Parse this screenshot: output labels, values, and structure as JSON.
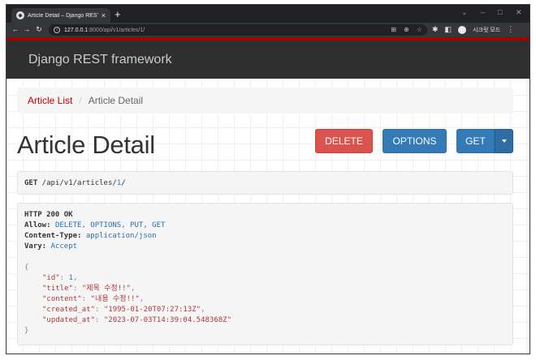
{
  "browser": {
    "tab_title": "Article Detail – Django REST fra...",
    "url_host": "127.0.0.1",
    "url_path": ":8000/api/v1/articles/1/",
    "profile_label": "시크릿 모드"
  },
  "navbar": {
    "brand": "Django REST framework"
  },
  "breadcrumb": {
    "link": "Article List",
    "separator": "/",
    "active": "Article Detail"
  },
  "page": {
    "title": "Article Detail"
  },
  "buttons": {
    "delete": "DELETE",
    "options": "OPTIONS",
    "get": "GET"
  },
  "request": {
    "method": "GET",
    "path_prefix": " /api/v1/articles/",
    "path_id": "1",
    "path_suffix": "/"
  },
  "response": {
    "status": "HTTP 200 OK",
    "headers": [
      {
        "key": "Allow:",
        "value": "DELETE, OPTIONS, PUT, GET"
      },
      {
        "key": "Content-Type:",
        "value": "application/json"
      },
      {
        "key": "Vary:",
        "value": "Accept"
      }
    ],
    "json_open": "{",
    "json_close": "}",
    "fields": [
      {
        "key": "\"id\"",
        "value": "1",
        "is_number": true,
        "trailing": ","
      },
      {
        "key": "\"title\"",
        "value": "\"제목 수정!!\"",
        "is_number": false,
        "trailing": ","
      },
      {
        "key": "\"content\"",
        "value": "\"내용 수정!!\"",
        "is_number": false,
        "trailing": ","
      },
      {
        "key": "\"created_at\"",
        "value": "\"1995-01-20T07:27:13Z\"",
        "is_number": false,
        "trailing": ","
      },
      {
        "key": "\"updated_at\"",
        "value": "\"2023-07-03T14:39:04.548368Z\"",
        "is_number": false,
        "trailing": ""
      }
    ]
  },
  "colors": {
    "navbar_bg": "#2f2f2f",
    "navbar_accent": "#a30000",
    "link": "#c20000",
    "delete": "#d9534f",
    "primary": "#337ab7"
  }
}
